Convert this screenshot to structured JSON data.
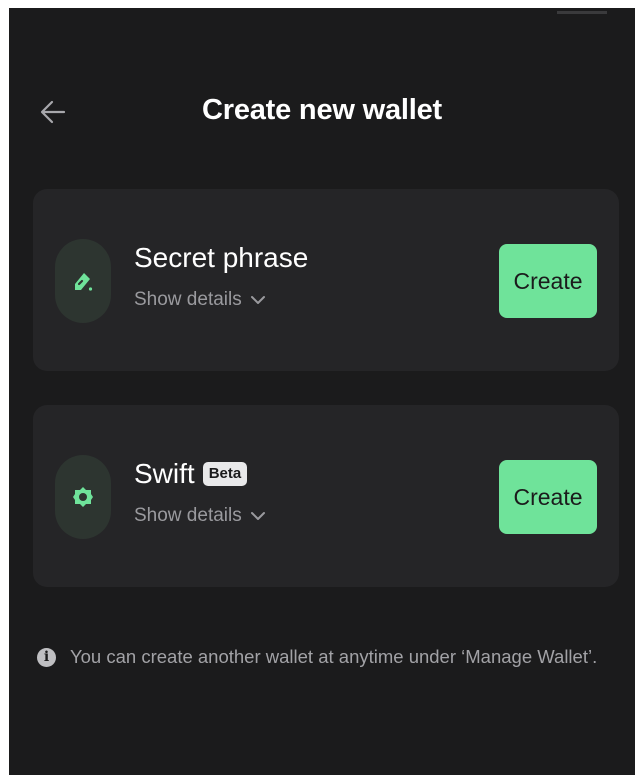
{
  "header": {
    "title": "Create new wallet",
    "back_icon": "arrow-left-icon"
  },
  "wallet_options": [
    {
      "title": "Secret phrase",
      "badge": "",
      "details_label": "Show details",
      "button_label": "Create",
      "icon": "pencil-icon"
    },
    {
      "title": "Swift",
      "badge": "Beta",
      "details_label": "Show details",
      "button_label": "Create",
      "icon": "swift-gear-icon"
    }
  ],
  "footer": {
    "info_text": "You can create another wallet at anytime under ‘Manage Wallet’.",
    "info_icon": "info-icon"
  },
  "colors": {
    "background": "#1b1b1c",
    "card": "#252527",
    "accent": "#6fe39a",
    "muted_text": "#9a9a9e"
  }
}
